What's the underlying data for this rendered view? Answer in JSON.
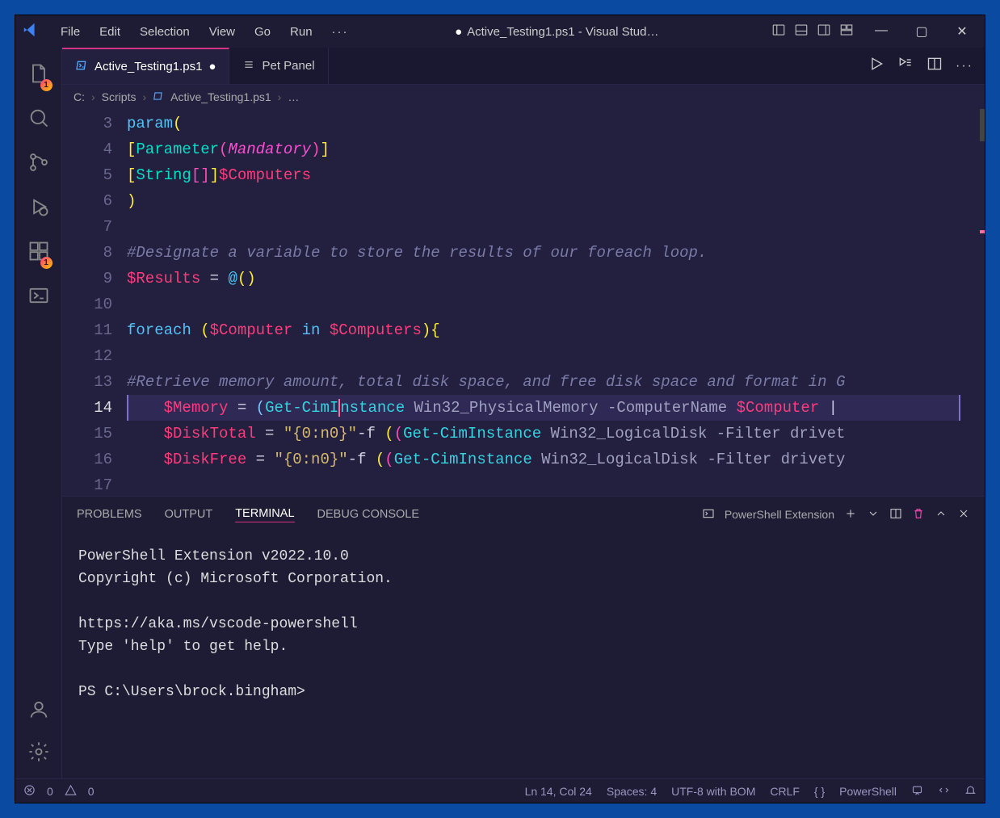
{
  "titlebar": {
    "menus": [
      "File",
      "Edit",
      "Selection",
      "View",
      "Go",
      "Run"
    ],
    "overflow": "···",
    "title": "Active_Testing1.ps1 - Visual Stud…"
  },
  "tabs": [
    {
      "label": "Active_Testing1.ps1",
      "active": true,
      "modified": true
    },
    {
      "label": "Pet Panel",
      "active": false,
      "modified": false
    }
  ],
  "breadcrumb": {
    "drive": "C:",
    "folder": "Scripts",
    "file": "Active_Testing1.ps1",
    "tail": "…"
  },
  "editor": {
    "line_start": 3,
    "current_line": 14,
    "lines": [
      {
        "n": 3,
        "tokens": [
          [
            "t-kw",
            "param"
          ],
          [
            "t-brk",
            "("
          ]
        ]
      },
      {
        "n": 4,
        "tokens": [
          [
            "t-brk",
            "["
          ],
          [
            "t-type",
            "Parameter"
          ],
          [
            "t-brk2",
            "("
          ],
          [
            "t-attr",
            "Mandatory"
          ],
          [
            "t-brk2",
            ")"
          ],
          [
            "t-brk",
            "]"
          ]
        ]
      },
      {
        "n": 5,
        "tokens": [
          [
            "t-brk",
            "["
          ],
          [
            "t-type",
            "String"
          ],
          [
            "t-brk2",
            "["
          ],
          [
            "t-brk2",
            "]"
          ],
          [
            "t-brk",
            "]"
          ],
          [
            "t-var",
            "$Computers"
          ]
        ]
      },
      {
        "n": 6,
        "tokens": [
          [
            "t-brk",
            ")"
          ]
        ]
      },
      {
        "n": 7,
        "tokens": []
      },
      {
        "n": 8,
        "tokens": [
          [
            "t-cmt",
            "#Designate a variable to store the results of our foreach loop."
          ]
        ]
      },
      {
        "n": 9,
        "tokens": [
          [
            "t-var",
            "$Results"
          ],
          [
            "t-plain",
            " = "
          ],
          [
            "t-kw",
            "@"
          ],
          [
            "t-brk",
            "("
          ],
          [
            "t-brk",
            ")"
          ]
        ]
      },
      {
        "n": 10,
        "tokens": []
      },
      {
        "n": 11,
        "tokens": [
          [
            "t-kw",
            "foreach "
          ],
          [
            "t-brk",
            "("
          ],
          [
            "t-var",
            "$Computer"
          ],
          [
            "t-kw",
            " in "
          ],
          [
            "t-var",
            "$Computers"
          ],
          [
            "t-brk",
            ")"
          ],
          [
            "t-brk",
            "{"
          ]
        ]
      },
      {
        "n": 12,
        "tokens": []
      },
      {
        "n": 13,
        "tokens": [
          [
            "t-cmt",
            "#Retrieve memory amount, total disk space, and free disk space and format in G"
          ]
        ]
      },
      {
        "n": 14,
        "tokens": [
          [
            "t-plain",
            "    "
          ],
          [
            "t-var",
            "$Memory"
          ],
          [
            "t-plain",
            " = "
          ],
          [
            "t-brk3",
            "("
          ],
          [
            "t-cmd",
            "Get-CimI"
          ],
          [
            "cursor",
            ""
          ],
          [
            "t-cmd",
            "nstance"
          ],
          [
            "t-arg",
            " Win32_PhysicalMemory "
          ],
          [
            "t-flag",
            "-ComputerName "
          ],
          [
            "t-var",
            "$Computer"
          ],
          [
            "t-plain",
            " | "
          ]
        ]
      },
      {
        "n": 15,
        "tokens": [
          [
            "t-plain",
            "    "
          ],
          [
            "t-var",
            "$DiskTotal"
          ],
          [
            "t-plain",
            " = "
          ],
          [
            "t-str",
            "\"{0:n0}\""
          ],
          [
            "t-plain",
            "-f "
          ],
          [
            "t-brk",
            "("
          ],
          [
            "t-brk2",
            "("
          ],
          [
            "t-cmd",
            "Get-CimInstance"
          ],
          [
            "t-arg",
            " Win32_LogicalDisk "
          ],
          [
            "t-flag",
            "-Filter drivet"
          ]
        ]
      },
      {
        "n": 16,
        "tokens": [
          [
            "t-plain",
            "    "
          ],
          [
            "t-var",
            "$DiskFree"
          ],
          [
            "t-plain",
            " = "
          ],
          [
            "t-str",
            "\"{0:n0}\""
          ],
          [
            "t-plain",
            "-f "
          ],
          [
            "t-brk",
            "("
          ],
          [
            "t-brk2",
            "("
          ],
          [
            "t-cmd",
            "Get-CimInstance"
          ],
          [
            "t-arg",
            " Win32_LogicalDisk "
          ],
          [
            "t-flag",
            "-Filter drivety"
          ]
        ]
      },
      {
        "n": 17,
        "tokens": []
      }
    ]
  },
  "panel": {
    "tabs": [
      "PROBLEMS",
      "OUTPUT",
      "TERMINAL",
      "DEBUG CONSOLE"
    ],
    "active": "TERMINAL",
    "dropdown": "PowerShell Extension",
    "terminal": "PowerShell Extension v2022.10.0\nCopyright (c) Microsoft Corporation.\n\nhttps://aka.ms/vscode-powershell\nType 'help' to get help.\n\nPS C:\\Users\\brock.bingham>"
  },
  "status": {
    "errors": "0",
    "warnings": "0",
    "position": "Ln 14, Col 24",
    "indent": "Spaces: 4",
    "encoding": "UTF-8 with BOM",
    "eol": "CRLF",
    "lang": "PowerShell"
  }
}
